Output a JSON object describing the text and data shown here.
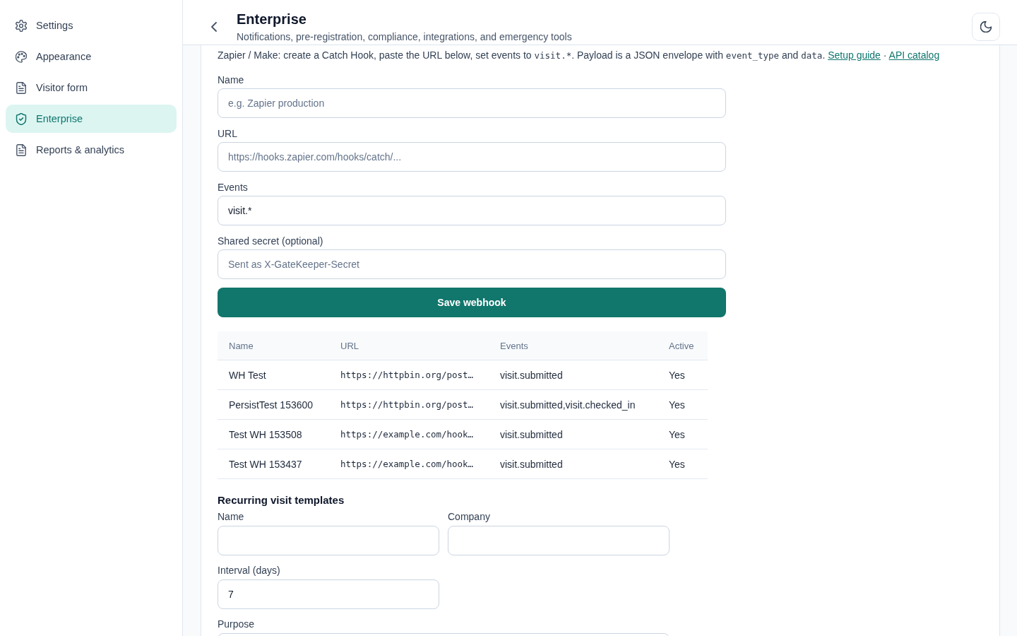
{
  "sidebar": {
    "items": [
      {
        "label": "Settings",
        "selected": false
      },
      {
        "label": "Appearance",
        "selected": false
      },
      {
        "label": "Visitor form",
        "selected": false
      },
      {
        "label": "Enterprise",
        "selected": true
      },
      {
        "label": "Reports & analytics",
        "selected": false
      }
    ]
  },
  "header": {
    "title": "Enterprise",
    "subtitle": "Notifications, pre-registration, compliance, integrations, and emergency tools"
  },
  "intro": {
    "segments": [
      {
        "kind": "text",
        "text": "Zapier / Make: create a Catch Hook, paste the URL below, set events to "
      },
      {
        "kind": "code",
        "text": "visit.*"
      },
      {
        "kind": "text",
        "text": ". Payload is a JSON envelope with "
      },
      {
        "kind": "code",
        "text": "event_type"
      },
      {
        "kind": "text",
        "text": " and "
      },
      {
        "kind": "code",
        "text": "data"
      },
      {
        "kind": "text",
        "text": ". "
      },
      {
        "kind": "link",
        "text": "Setup guide"
      },
      {
        "kind": "text",
        "text": " · "
      },
      {
        "kind": "link",
        "text": "API catalog"
      }
    ]
  },
  "webhook_form": {
    "fields": [
      {
        "label": "Name",
        "placeholder": "e.g. Zapier production"
      },
      {
        "label": "URL",
        "placeholder": "https://hooks.zapier.com/hooks/catch/..."
      },
      {
        "label": "Events",
        "value": "visit.*"
      },
      {
        "label": "Shared secret (optional)",
        "placeholder": "Sent as X-GateKeeper-Secret"
      }
    ],
    "submit": "Save webhook"
  },
  "webhooks_table": {
    "columns": [
      "Name",
      "URL",
      "Events",
      "Active"
    ],
    "rows": [
      [
        "WH Test",
        "https://httpbin.org/post…",
        "visit.submitted",
        "Yes"
      ],
      [
        "PersistTest 153600",
        "https://httpbin.org/post…",
        "visit.submitted,visit.checked_in",
        "Yes"
      ],
      [
        "Test WH 153508",
        "https://example.com/hook…",
        "visit.submitted",
        "Yes"
      ],
      [
        "Test WH 153437",
        "https://example.com/hook…",
        "visit.submitted",
        "Yes"
      ]
    ]
  },
  "recurring_templates": {
    "title": "Recurring visit templates",
    "fields": [
      {
        "label": "Name",
        "kind": "text"
      },
      {
        "label": "Company",
        "kind": "text"
      },
      {
        "label": "Interval (days)",
        "kind": "number",
        "value": "7"
      },
      {
        "label": "Purpose",
        "kind": "textarea"
      }
    ]
  }
}
